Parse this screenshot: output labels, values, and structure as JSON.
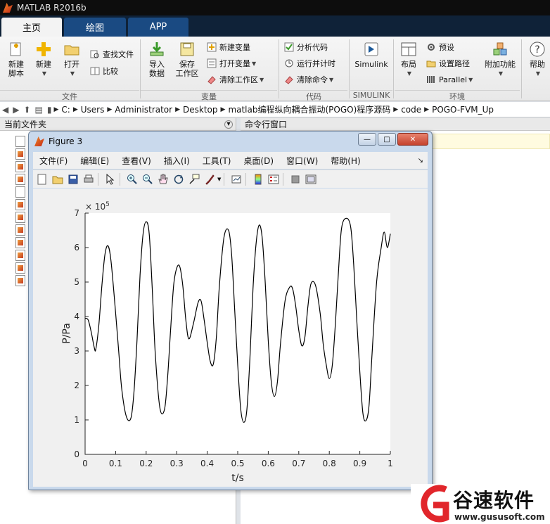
{
  "app": {
    "title": "MATLAB R2016b"
  },
  "tabs": [
    "主页",
    "绘图",
    "APP"
  ],
  "ribbon": {
    "file": {
      "new_script": "新建\n脚本",
      "new": "新建",
      "open": "打开",
      "find_files": "查找文件",
      "compare": "比较",
      "group": "文件"
    },
    "variable": {
      "import": "导入\n数据",
      "save_ws": "保存\n工作区",
      "new_var": "新建变量",
      "open_var": "打开变量",
      "clear_ws": "清除工作区",
      "group": "变量"
    },
    "code": {
      "analyze": "分析代码",
      "run_time": "运行并计时",
      "clear_cmd": "清除命令",
      "group": "代码"
    },
    "simulink": {
      "label": "Simulink",
      "group": "SIMULINK"
    },
    "env": {
      "layout": "布局",
      "prefs": "预设",
      "set_path": "设置路径",
      "parallel": "Parallel",
      "addons": "附加功能",
      "group": "环境"
    },
    "help": "帮助"
  },
  "address": [
    "C:",
    "Users",
    "Administrator",
    "Desktop",
    "matlab编程纵向耦合振动(POGO)程序源码",
    "code",
    "POGO-FVM_Up"
  ],
  "panels": {
    "current_folder": "当前文件夹",
    "command_window": "命令行窗口"
  },
  "figure": {
    "title": "Figure 3",
    "menu": [
      "文件(F)",
      "编辑(E)",
      "查看(V)",
      "插入(I)",
      "工具(T)",
      "桌面(D)",
      "窗口(W)",
      "帮助(H)"
    ]
  },
  "watermark": {
    "brand": "谷速软件",
    "url": "www.gususoft.com"
  },
  "chart_data": {
    "type": "line",
    "xlabel": "t/s",
    "ylabel": "P/Pa",
    "exponent_label": "× 10^5",
    "xlim": [
      0,
      1
    ],
    "ylim": [
      0,
      7
    ],
    "xticks": [
      "0",
      "0.1",
      "0.2",
      "0.3",
      "0.4",
      "0.5",
      "0.6",
      "0.7",
      "0.8",
      "0.9",
      "1"
    ],
    "yticks": [
      "0",
      "1",
      "2",
      "3",
      "4",
      "5",
      "6",
      "7"
    ],
    "grid": false,
    "series": [
      {
        "color": "#000000",
        "x": [
          0,
          0.01,
          0.02,
          0.03,
          0.035,
          0.045,
          0.055,
          0.065,
          0.075,
          0.085,
          0.1,
          0.11,
          0.12,
          0.135,
          0.15,
          0.16,
          0.17,
          0.18,
          0.19,
          0.2,
          0.21,
          0.22,
          0.23,
          0.245,
          0.26,
          0.27,
          0.28,
          0.29,
          0.3,
          0.31,
          0.32,
          0.33,
          0.34,
          0.355,
          0.37,
          0.38,
          0.39,
          0.4,
          0.41,
          0.42,
          0.43,
          0.44,
          0.455,
          0.47,
          0.48,
          0.49,
          0.5,
          0.51,
          0.52,
          0.53,
          0.54,
          0.55,
          0.56,
          0.57,
          0.58,
          0.59,
          0.6,
          0.61,
          0.62,
          0.63,
          0.64,
          0.655,
          0.67,
          0.68,
          0.69,
          0.7,
          0.71,
          0.72,
          0.73,
          0.74,
          0.755,
          0.77,
          0.78,
          0.79,
          0.8,
          0.81,
          0.82,
          0.83,
          0.84,
          0.855,
          0.87,
          0.88,
          0.89,
          0.9,
          0.91,
          0.92,
          0.93,
          0.94,
          0.955,
          0.97,
          0.98,
          0.99,
          1.0
        ],
        "y": [
          3.95,
          3.9,
          3.55,
          3.1,
          3.05,
          3.75,
          4.9,
          5.8,
          6.05,
          5.6,
          4.1,
          3.0,
          1.9,
          1.1,
          1.05,
          1.8,
          3.3,
          5.2,
          6.4,
          6.75,
          6.4,
          4.8,
          2.9,
          1.35,
          1.3,
          2.2,
          3.6,
          4.9,
          5.4,
          5.45,
          4.9,
          3.9,
          3.35,
          3.8,
          4.4,
          4.45,
          3.9,
          3.25,
          2.7,
          2.62,
          3.4,
          4.9,
          6.3,
          6.5,
          5.8,
          4.2,
          2.6,
          1.3,
          0.93,
          1.3,
          2.8,
          4.8,
          6.1,
          6.65,
          6.3,
          5.0,
          3.3,
          2.1,
          1.68,
          2.1,
          3.2,
          4.45,
          4.85,
          4.8,
          4.3,
          3.6,
          3.15,
          3.4,
          4.3,
          4.95,
          4.9,
          4.1,
          3.2,
          2.6,
          2.2,
          2.6,
          3.8,
          5.3,
          6.55,
          6.85,
          6.6,
          5.5,
          3.9,
          2.4,
          1.2,
          0.98,
          1.4,
          2.9,
          5.0,
          6.0,
          6.45,
          6.0,
          6.4
        ]
      }
    ]
  }
}
